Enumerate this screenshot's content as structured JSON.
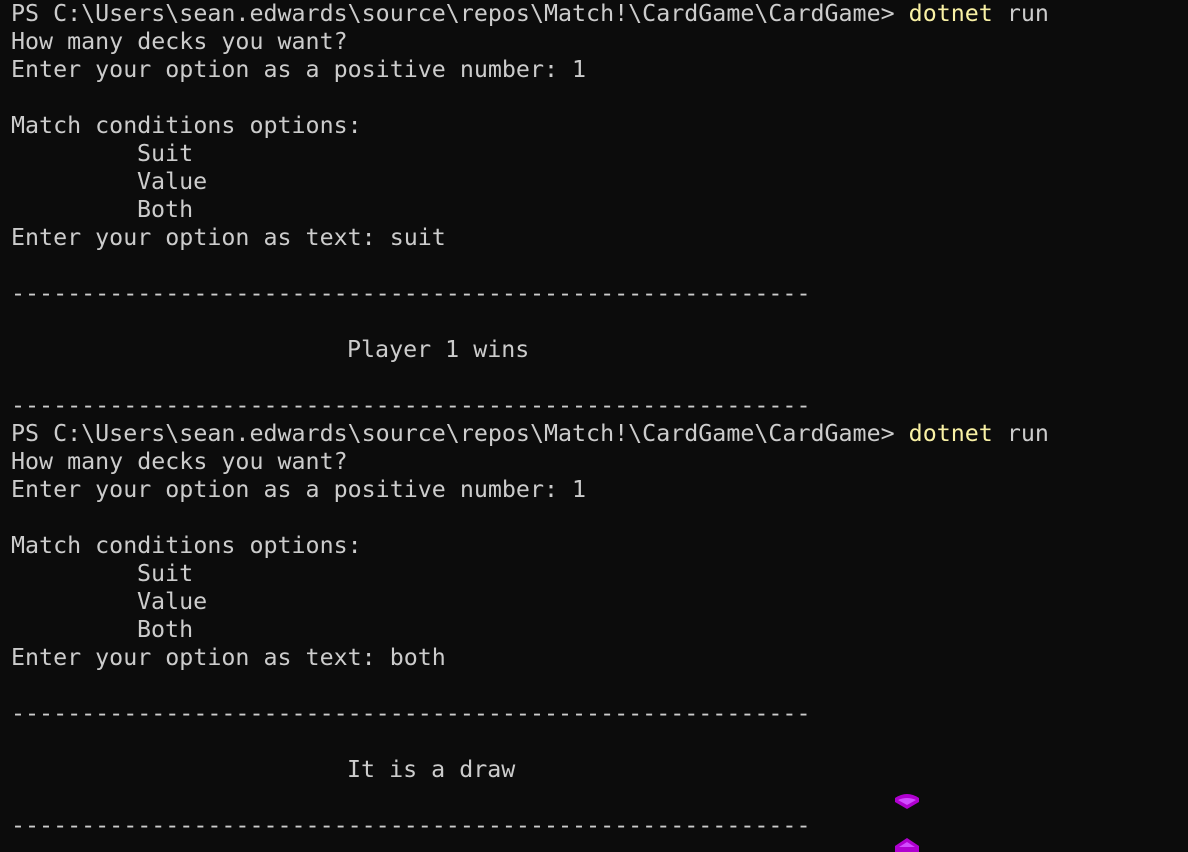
{
  "terminal": {
    "dash_rule": "----------------------------------------------------------",
    "colors": {
      "background": "#0c0c0c",
      "text": "#cccccc",
      "command": "#f9f1a5",
      "cursor_accent": "#b000d0"
    },
    "sessions": [
      {
        "prompt": "PS C:\\Users\\sean.edwards\\source\\repos\\Match!\\CardGame\\CardGame> ",
        "command_name": "dotnet",
        "command_args": " run",
        "decks_question": "How many decks you want?",
        "decks_prompt": "Enter your option as a positive number: 1",
        "conditions_header": "Match conditions options:",
        "conditions_options": [
          "Suit",
          "Value",
          "Both"
        ],
        "conditions_prompt": "Enter your option as text: suit",
        "result": "Player 1 wins"
      },
      {
        "prompt": "PS C:\\Users\\sean.edwards\\source\\repos\\Match!\\CardGame\\CardGame> ",
        "command_name": "dotnet",
        "command_args": " run",
        "decks_question": "How many decks you want?",
        "decks_prompt": "Enter your option as a positive number: 1",
        "conditions_header": "Match conditions options:",
        "conditions_options": [
          "Suit",
          "Value",
          "Both"
        ],
        "conditions_prompt": "Enter your option as text: both",
        "result": "It is a draw"
      }
    ]
  }
}
